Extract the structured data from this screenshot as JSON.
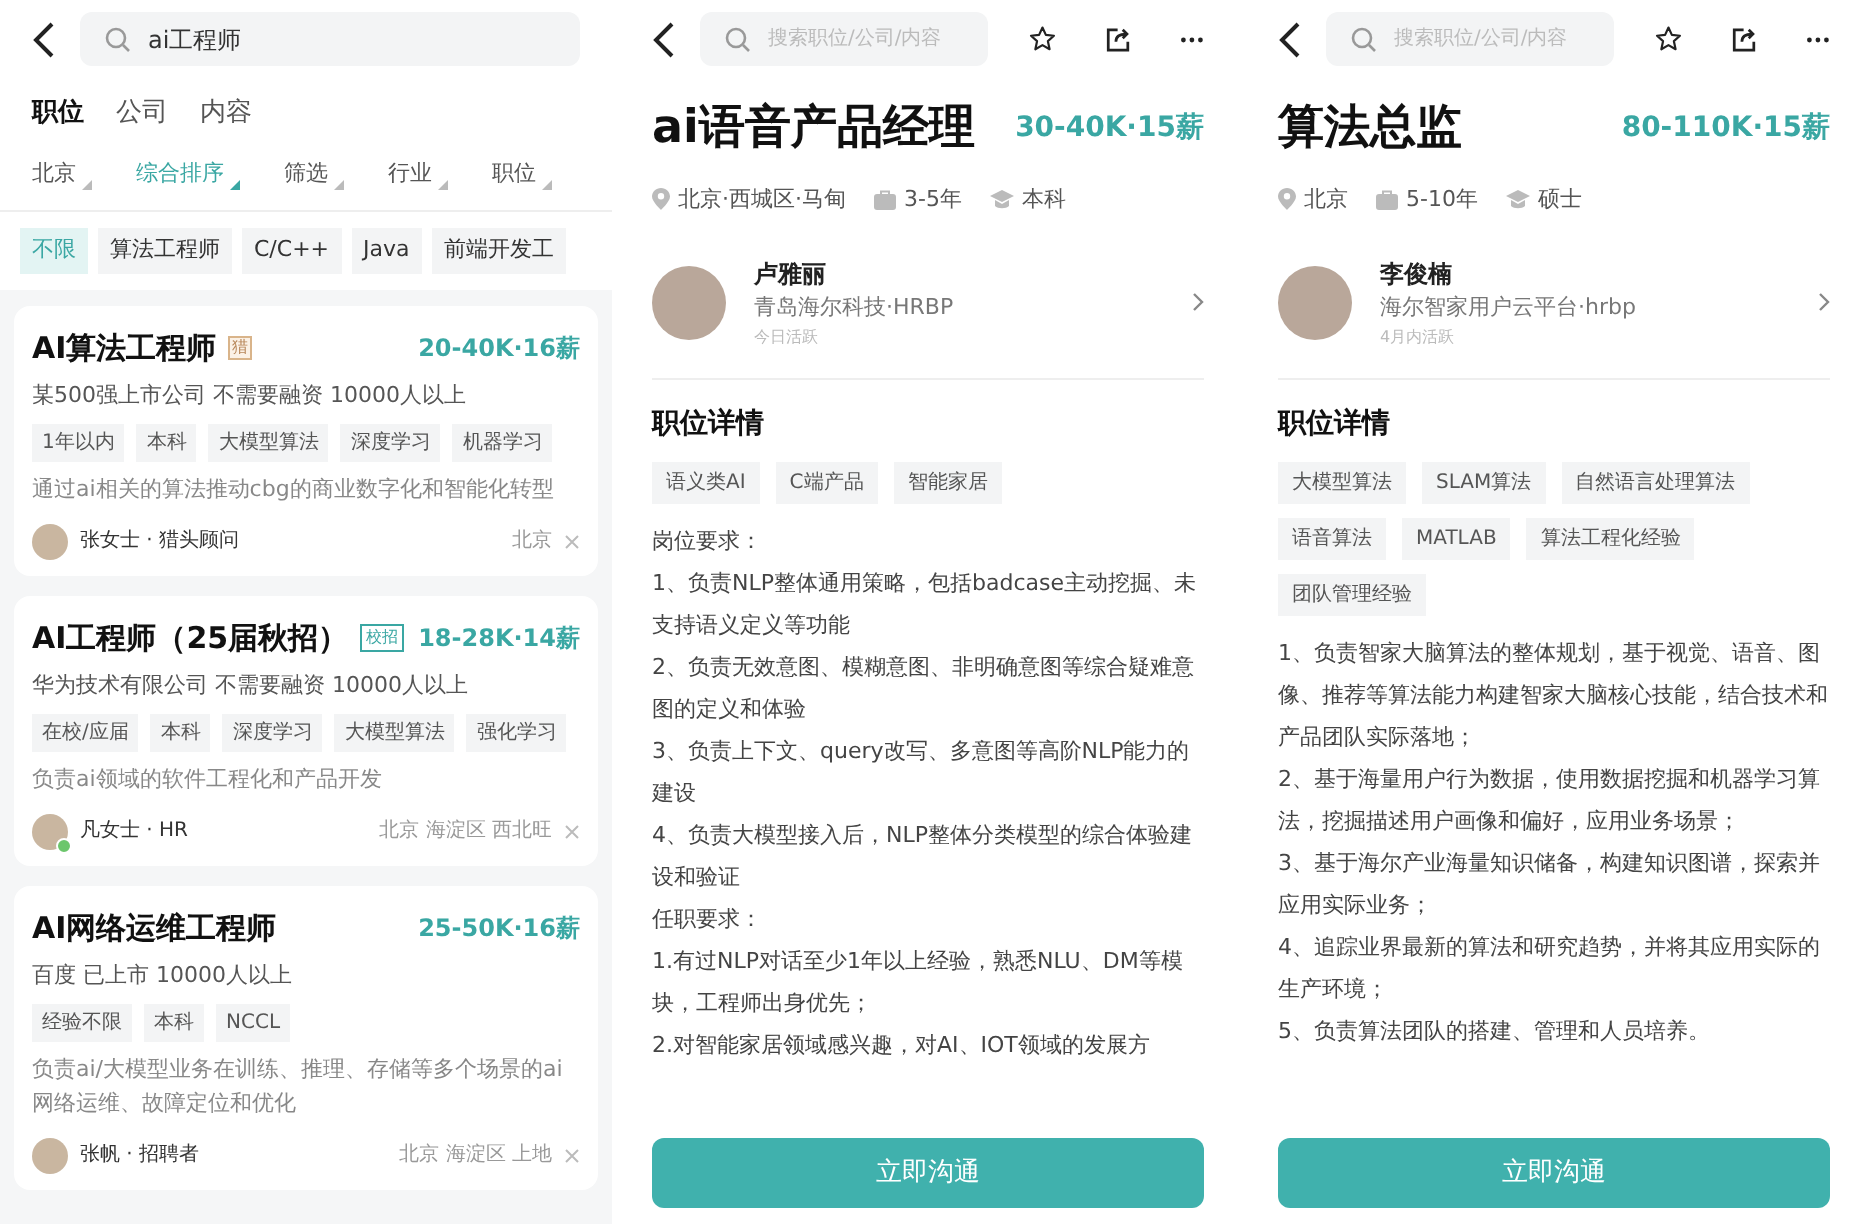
{
  "search_list": {
    "query": "ai工程师",
    "tabs": [
      {
        "label": "职位",
        "selected": true
      },
      {
        "label": "公司",
        "selected": false
      },
      {
        "label": "内容",
        "selected": false
      }
    ],
    "filters": [
      {
        "label": "北京",
        "selected": false
      },
      {
        "label": "综合排序",
        "selected": true
      },
      {
        "label": "筛选",
        "selected": false
      },
      {
        "label": "行业",
        "selected": false
      },
      {
        "label": "职位",
        "selected": false
      }
    ],
    "chips": [
      {
        "label": "不限",
        "selected": true
      },
      {
        "label": "算法工程师",
        "selected": false
      },
      {
        "label": "C/C++",
        "selected": false
      },
      {
        "label": "Java",
        "selected": false
      },
      {
        "label": "前端开发工",
        "selected": false
      }
    ],
    "jobs": [
      {
        "title": "AI算法工程师",
        "badge": {
          "kind": "hunter",
          "text": "猎"
        },
        "salary": "20-40K·16薪",
        "company": "某500强上市公司 不需要融资 10000人以上",
        "tags": [
          "1年以内",
          "本科",
          "大模型算法",
          "深度学习",
          "机器学习"
        ],
        "description": "通过ai相关的算法推动cbg的商业数字化和智能化转型",
        "recruiter": "张女士 · 猎头顾问",
        "online": false,
        "location": "北京"
      },
      {
        "title": "AI工程师（25届秋招）",
        "badge": {
          "kind": "campus",
          "text": "校招"
        },
        "salary": "18-28K·14薪",
        "company": "华为技术有限公司 不需要融资 10000人以上",
        "tags": [
          "在校/应届",
          "本科",
          "深度学习",
          "大模型算法",
          "强化学习"
        ],
        "description": "负责ai领域的软件工程化和产品开发",
        "recruiter": "凡女士 · HR",
        "online": true,
        "location": "北京 海淀区 西北旺"
      },
      {
        "title": "AI网络运维工程师",
        "salary": "25-50K·16薪",
        "company": "百度 已上市 10000人以上",
        "tags": [
          "经验不限",
          "本科",
          "NCCL"
        ],
        "description": "负责ai/大模型业务在训练、推理、存储等多个场景的ai网络运维、故障定位和优化",
        "recruiter": "张帆 · 招聘者",
        "online": false,
        "location": "北京 海淀区 上地"
      }
    ]
  },
  "details": [
    {
      "search_placeholder": "搜索职位/公司/内容",
      "title": "ai语音产品经理",
      "salary": "30-40K·15薪",
      "location": "北京·西城区·马甸",
      "experience": "3-5年",
      "education": "本科",
      "recruiter": {
        "name": "卢雅丽",
        "company": "青岛海尔科技·HRBP",
        "activity": "今日活跃"
      },
      "section_title": "职位详情",
      "tags": [
        "语义类AI",
        "C端产品",
        "智能家居"
      ],
      "paragraphs": [
        "岗位要求：",
        "1、负责NLP整体通用策略，包括badcase主动挖掘、未支持语义定义等功能",
        "2、负责无效意图、模糊意图、非明确意图等综合疑难意图的定义和体验",
        "3、负责上下文、query改写、多意图等高阶NLP能力的建设",
        "4、负责大模型接入后，NLP整体分类模型的综合体验建设和验证",
        "任职要求：",
        "1.有过NLP对话至少1年以上经验，熟悉NLU、DM等模块，工程师出身优先；",
        "2.对智能家居领域感兴趣，对AI、IOT领域的发展方"
      ],
      "button": "立即沟通"
    },
    {
      "search_placeholder": "搜索职位/公司/内容",
      "title": "算法总监",
      "salary": "80-110K·15薪",
      "location": "北京",
      "experience": "5-10年",
      "education": "硕士",
      "recruiter": {
        "name": "李俊楠",
        "company": "海尔智家用户云平台·hrbp",
        "activity": "4月内活跃"
      },
      "section_title": "职位详情",
      "tags": [
        "大模型算法",
        "SLAM算法",
        "自然语言处理算法",
        "语音算法",
        "MATLAB",
        "算法工程化经验",
        "团队管理经验"
      ],
      "paragraphs": [
        "1、负责智家大脑算法的整体规划，基于视觉、语音、图像、推荐等算法能力构建智家大脑核心技能，结合技术和产品团队实际落地；",
        "2、基于海量用户行为数据，使用数据挖掘和机器学习算法，挖掘描述用户画像和偏好，应用业务场景；",
        "3、基于海尔产业海量知识储备，构建知识图谱，探索并应用实际业务；",
        "4、追踪业界最新的算法和研究趋势，并将其应用实际的生产环境；",
        "5、负责算法团队的搭建、管理和人员培养。"
      ],
      "button": "立即沟通"
    }
  ]
}
